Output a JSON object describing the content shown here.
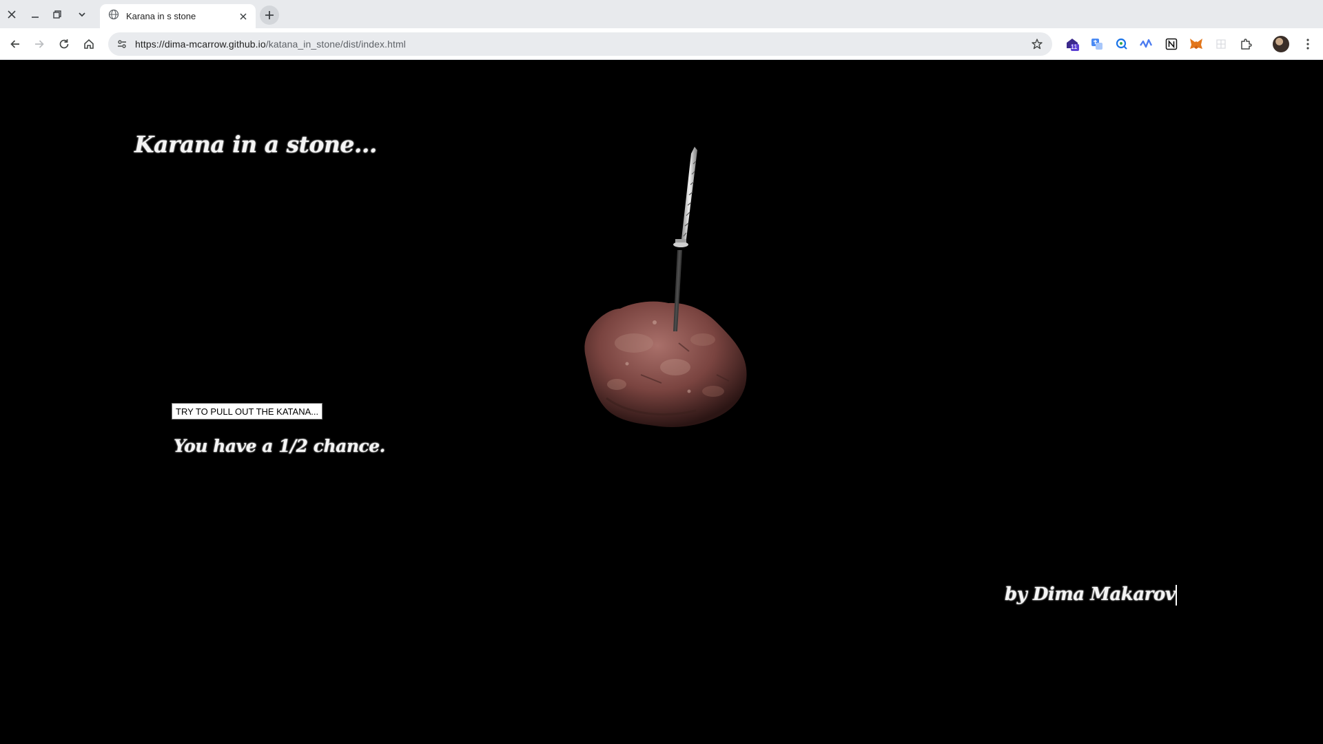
{
  "browser": {
    "tab_title": "Karana in s stone",
    "url_host": "https://dima-mcarrow.github.io",
    "url_path": "/katana_in_stone/dist/index.html",
    "extension_badge": "11"
  },
  "page": {
    "title": "Karana in a stone...",
    "pull_button_label": "TRY TO PULL OUT THE KATANA...",
    "chance_text": "You have a 1/2 chance.",
    "author": "by Dima Makarov"
  }
}
